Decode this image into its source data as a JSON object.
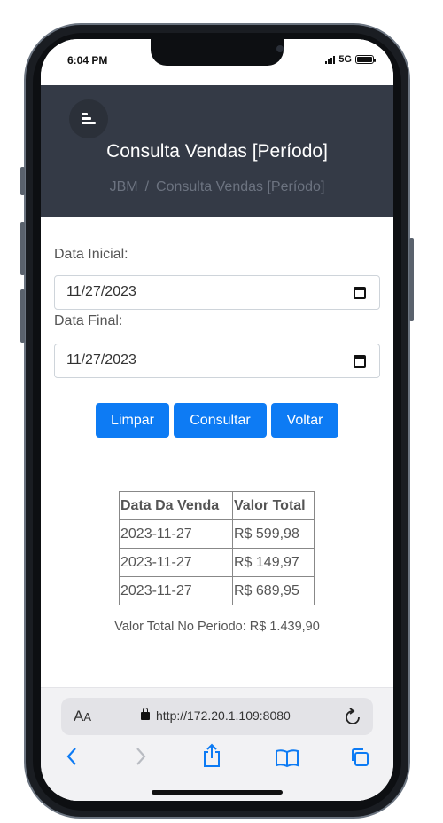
{
  "status": {
    "time": "6:04 PM",
    "network": "5G"
  },
  "header": {
    "title": "Consulta Vendas [Período]",
    "breadcrumb": [
      "JBM",
      "Consulta Vendas [Período]"
    ]
  },
  "form": {
    "start_label": "Data Inicial:",
    "start_value": "11/27/2023",
    "end_label": "Data Final:",
    "end_value": "11/27/2023"
  },
  "buttons": {
    "clear": "Limpar",
    "query": "Consultar",
    "back": "Voltar"
  },
  "table": {
    "headers": [
      "Data Da Venda",
      "Valor Total"
    ],
    "rows": [
      [
        "2023-11-27",
        "R$ 599,98"
      ],
      [
        "2023-11-27",
        "R$ 149,97"
      ],
      [
        "2023-11-27",
        "R$ 689,95"
      ]
    ]
  },
  "total": "Valor Total No Período: R$ 1.439,90",
  "browser": {
    "text_size_label": {
      "big": "A",
      "small": "A"
    },
    "url": "http://172.20.1.109:8080"
  },
  "colors": {
    "header_bg": "#343a46",
    "button": "#0d7bf4",
    "toolbar_icon": "#0d7bf4"
  },
  "icons": [
    "menu-icon",
    "calendar-icon",
    "lock-icon",
    "reload-icon",
    "back-icon",
    "forward-icon",
    "share-icon",
    "bookmarks-icon",
    "tabs-icon"
  ]
}
